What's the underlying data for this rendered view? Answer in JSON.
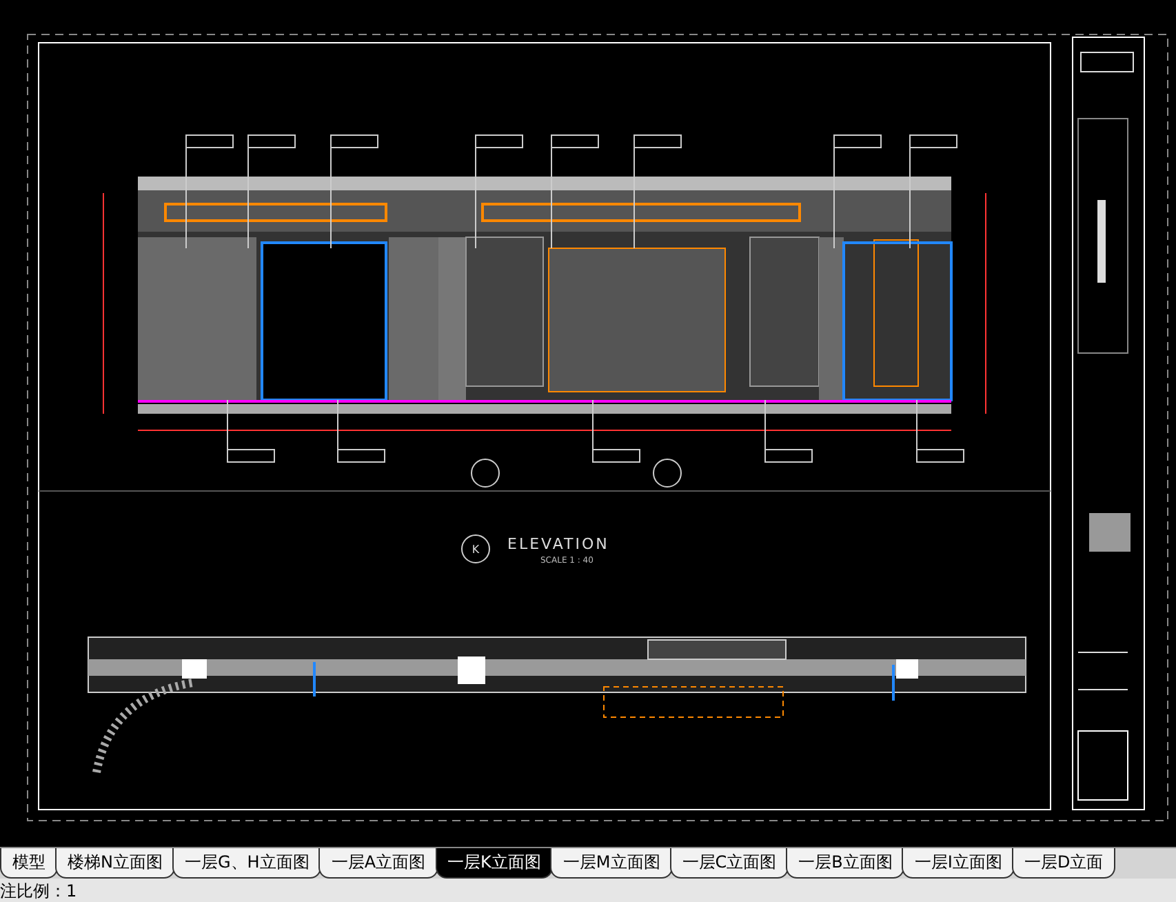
{
  "drawing": {
    "elevation_marker": "K",
    "elevation_title": "ELEVATION",
    "scale": "SCALE 1 : 40"
  },
  "tabs": [
    {
      "label": "模型",
      "selected": false
    },
    {
      "label": "楼梯N立面图",
      "selected": false
    },
    {
      "label": "一层G、H立面图",
      "selected": false
    },
    {
      "label": "一层A立面图",
      "selected": false
    },
    {
      "label": "一层K立面图",
      "selected": true
    },
    {
      "label": "一层M立面图",
      "selected": false
    },
    {
      "label": "一层C立面图",
      "selected": false
    },
    {
      "label": "一层B立面图",
      "selected": false
    },
    {
      "label": "一层I立面图",
      "selected": false
    },
    {
      "label": "一层D立面",
      "selected": false
    }
  ],
  "status_bar": {
    "annotation_scale": "注比例：1"
  }
}
